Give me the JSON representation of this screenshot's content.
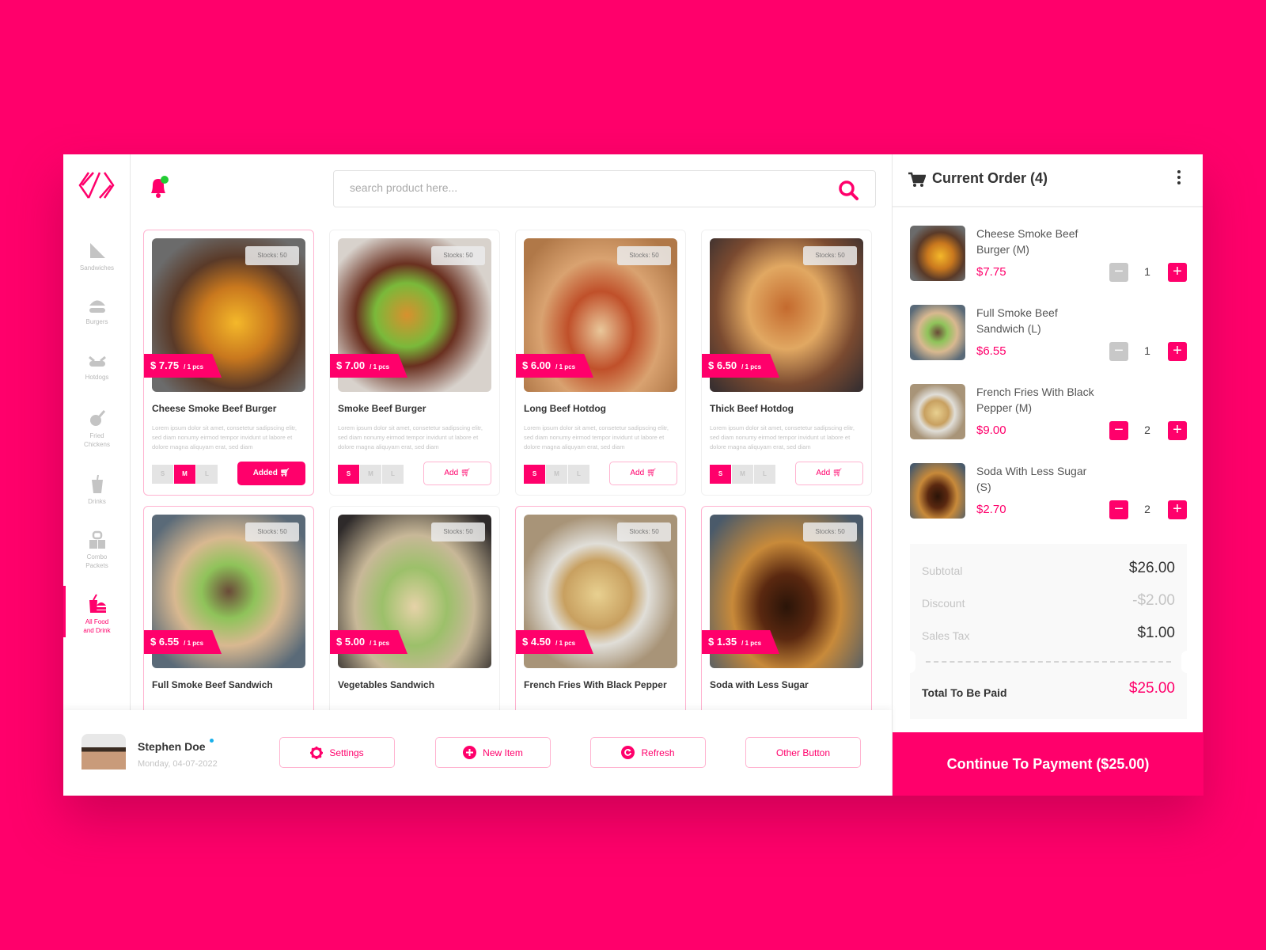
{
  "brand": {
    "accent": "#ff006b"
  },
  "sidebar": {
    "items": [
      {
        "label": "Sandwiches",
        "icon": "sandwich-icon"
      },
      {
        "label": "Burgers",
        "icon": "burger-icon"
      },
      {
        "label": "Hotdogs",
        "icon": "hotdog-icon"
      },
      {
        "label": "Fried Chickens",
        "icon": "chicken-leg-icon"
      },
      {
        "label": "Drinks",
        "icon": "drink-icon"
      },
      {
        "label": "Combo Packets",
        "icon": "combo-icon"
      },
      {
        "label": "All Food and Drink",
        "icon": "all-food-icon",
        "active": true
      }
    ]
  },
  "search": {
    "placeholder": "search product here..."
  },
  "products": [
    {
      "name": "Cheese Smoke Beef Burger",
      "price": "$ 7.75",
      "unit": "/ 1 pcs",
      "stock": "Stocks: 50",
      "desc": "Lorem ipsum dolor sit amet, consetetur sadipscing elitr, sed diam nonumy eirmod tempor invidunt ut labore et dolore magna aliquyam erat, sed diam",
      "sizes": [
        "S",
        "M",
        "L"
      ],
      "size": "M",
      "button": "Added"
    },
    {
      "name": "Smoke Beef Burger",
      "price": "$ 7.00",
      "unit": "/ 1 pcs",
      "stock": "Stocks: 50",
      "desc": "Lorem ipsum dolor sit amet, consetetur sadipscing elitr, sed diam nonumy eirmod tempor invidunt ut labore et dolore magna aliquyam erat, sed diam",
      "sizes": [
        "S",
        "M",
        "L"
      ],
      "size": "S",
      "button": "Add"
    },
    {
      "name": "Long Beef Hotdog",
      "price": "$ 6.00",
      "unit": "/ 1 pcs",
      "stock": "Stocks: 50",
      "desc": "Lorem ipsum dolor sit amet, consetetur sadipscing elitr, sed diam nonumy eirmod tempor invidunt ut labore et dolore magna aliquyam erat, sed diam",
      "sizes": [
        "S",
        "M",
        "L"
      ],
      "size": "S",
      "button": "Add"
    },
    {
      "name": "Thick Beef Hotdog",
      "price": "$ 6.50",
      "unit": "/ 1 pcs",
      "stock": "Stocks: 50",
      "desc": "Lorem ipsum dolor sit amet, consetetur sadipscing elitr, sed diam nonumy eirmod tempor invidunt ut labore et dolore magna aliquyam erat, sed diam",
      "sizes": [
        "S",
        "M",
        "L"
      ],
      "size": "S",
      "button": "Add"
    },
    {
      "name": "Full Smoke Beef Sandwich",
      "price": "$ 6.55",
      "unit": "/ 1 pcs",
      "stock": "Stocks: 50"
    },
    {
      "name": "Vegetables Sandwich",
      "price": "$ 5.00",
      "unit": "/ 1 pcs",
      "stock": "Stocks: 50"
    },
    {
      "name": "French Fries With Black Pepper",
      "price": "$ 4.50",
      "unit": "/ 1 pcs",
      "stock": "Stocks: 50"
    },
    {
      "name": "Soda with Less Sugar",
      "price": "$ 1.35",
      "unit": "/ 1 pcs",
      "stock": "Stocks: 50"
    }
  ],
  "user": {
    "name": "Stephen Doe",
    "date": "Monday, 04-07-2022"
  },
  "actions": {
    "settings": "Settings",
    "new_item": "New Item",
    "refresh": "Refresh",
    "other": "Other Button"
  },
  "cart": {
    "title": "Current Order (4)",
    "items": [
      {
        "name": "Cheese Smoke Beef Burger (M)",
        "price": "$7.75",
        "qty": "1"
      },
      {
        "name": "Full Smoke Beef Sandwich (L)",
        "price": "$6.55",
        "qty": "1"
      },
      {
        "name": "French Fries With Black Pepper (M)",
        "price": "$9.00",
        "qty": "2"
      },
      {
        "name": "Soda With Less Sugar (S)",
        "price": "$2.70",
        "qty": "2"
      }
    ],
    "summary": {
      "subtotal_label": "Subtotal",
      "subtotal": "$26.00",
      "discount_label": "Discount",
      "discount": "-$2.00",
      "tax_label": "Sales Tax",
      "tax": "$1.00",
      "total_label": "Total To Be Paid",
      "total": "$25.00"
    },
    "pay_label": "Continue To Payment ($25.00)"
  }
}
